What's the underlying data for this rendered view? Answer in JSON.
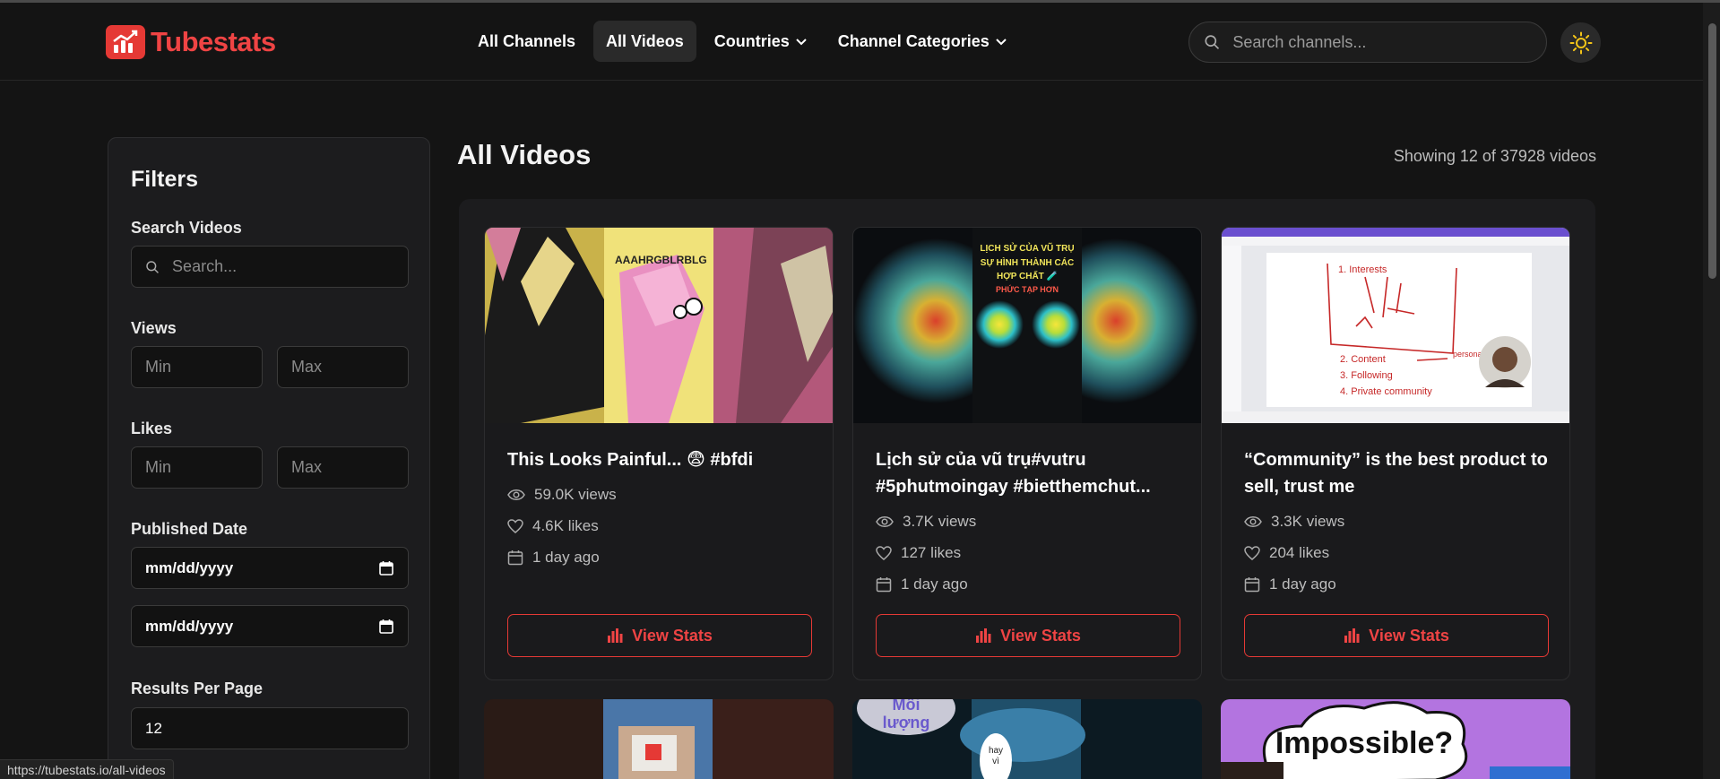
{
  "brand": {
    "name": "Tubestats"
  },
  "nav": {
    "items": [
      {
        "label": "All Channels"
      },
      {
        "label": "All Videos"
      },
      {
        "label": "Countries"
      },
      {
        "label": "Channel Categories"
      }
    ],
    "active_index": 1
  },
  "search": {
    "placeholder": "Search channels..."
  },
  "filters": {
    "title": "Filters",
    "search_videos": {
      "label": "Search Videos",
      "placeholder": "Search..."
    },
    "views": {
      "label": "Views",
      "min_placeholder": "Min",
      "max_placeholder": "Max"
    },
    "likes": {
      "label": "Likes",
      "min_placeholder": "Min",
      "max_placeholder": "Max"
    },
    "published_date": {
      "label": "Published Date",
      "from_value": "mm/dd/yyyy",
      "to_value": "mm/dd/yyyy"
    },
    "results_per_page": {
      "label": "Results Per Page",
      "value": "12"
    }
  },
  "main": {
    "title": "All Videos",
    "showing": "Showing 12 of 37928 videos",
    "cards": [
      {
        "title": "This Looks Painful... 😨 #bfdi",
        "views": "59.0K views",
        "likes": "4.6K likes",
        "date": "1 day ago",
        "button": "View Stats",
        "thumb_text": "AAAHRGBLRBLG"
      },
      {
        "title": "Lịch sử của vũ trụ#vutru #5phutmoingay #bietthemchut...",
        "views": "3.7K views",
        "likes": "127 likes",
        "date": "1 day ago",
        "button": "View Stats",
        "thumb_text_1": "LỊCH SỬ CỦA VŨ TRỤ",
        "thumb_text_2": "SỰ HÌNH THÀNH CÁC",
        "thumb_text_3": "HỢP CHẤT 🧪",
        "thumb_text_4": "PHỨC TẠP HƠN"
      },
      {
        "title": "“Community” is the best product to sell, trust me",
        "views": "3.3K views",
        "likes": "204 likes",
        "date": "1 day ago",
        "button": "View Stats",
        "wb_1": "1. Interests",
        "wb_2": "2. Content",
        "wb_3": "3. Following",
        "wb_4": "4. Private community",
        "wb_5": "personality"
      }
    ],
    "row2": {
      "c2_text_1": "Mỗi",
      "c2_text_2": "lượng",
      "c2_text_3": "hay",
      "c2_text_4": "vì",
      "c3_text": "Impossible?"
    }
  },
  "status_url": "https://tubestats.io/all-videos",
  "colors": {
    "accent": "#ef4444",
    "background": "#141414",
    "card": "#1a1a1c"
  }
}
